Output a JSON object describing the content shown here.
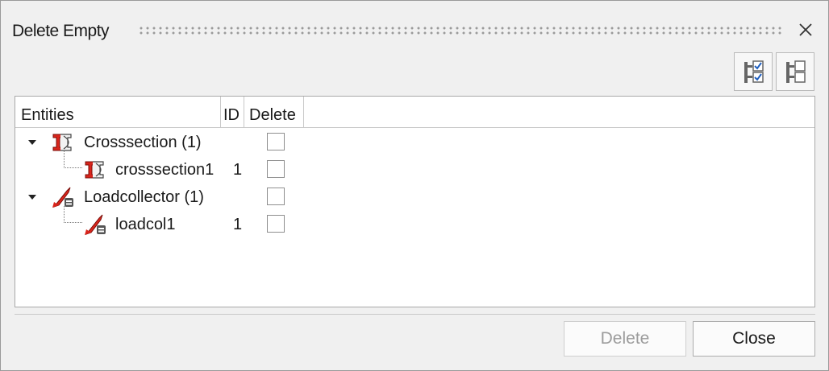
{
  "window": {
    "title": "Delete Empty"
  },
  "toolbar": {
    "check_all_icon": "tree-checked-icon",
    "uncheck_all_icon": "tree-unchecked-icon"
  },
  "table": {
    "columns": [
      "Entities",
      "ID",
      "Delete"
    ],
    "rows": [
      {
        "label": "Crosssection (1)",
        "id": "",
        "icon": "crosssection-icon",
        "level": 0,
        "expanded": true,
        "checked": false
      },
      {
        "label": "crosssection1",
        "id": "1",
        "icon": "crosssection-icon",
        "level": 1,
        "checked": false
      },
      {
        "label": "Loadcollector (1)",
        "id": "",
        "icon": "loadcollector-icon",
        "level": 0,
        "expanded": true,
        "checked": false
      },
      {
        "label": "loadcol1",
        "id": "1",
        "icon": "loadcollector-icon",
        "level": 1,
        "checked": false
      }
    ]
  },
  "buttons": {
    "delete": "Delete",
    "close": "Close"
  },
  "colors": {
    "accent_red": "#d9251c",
    "check_blue": "#1f5fbf"
  }
}
